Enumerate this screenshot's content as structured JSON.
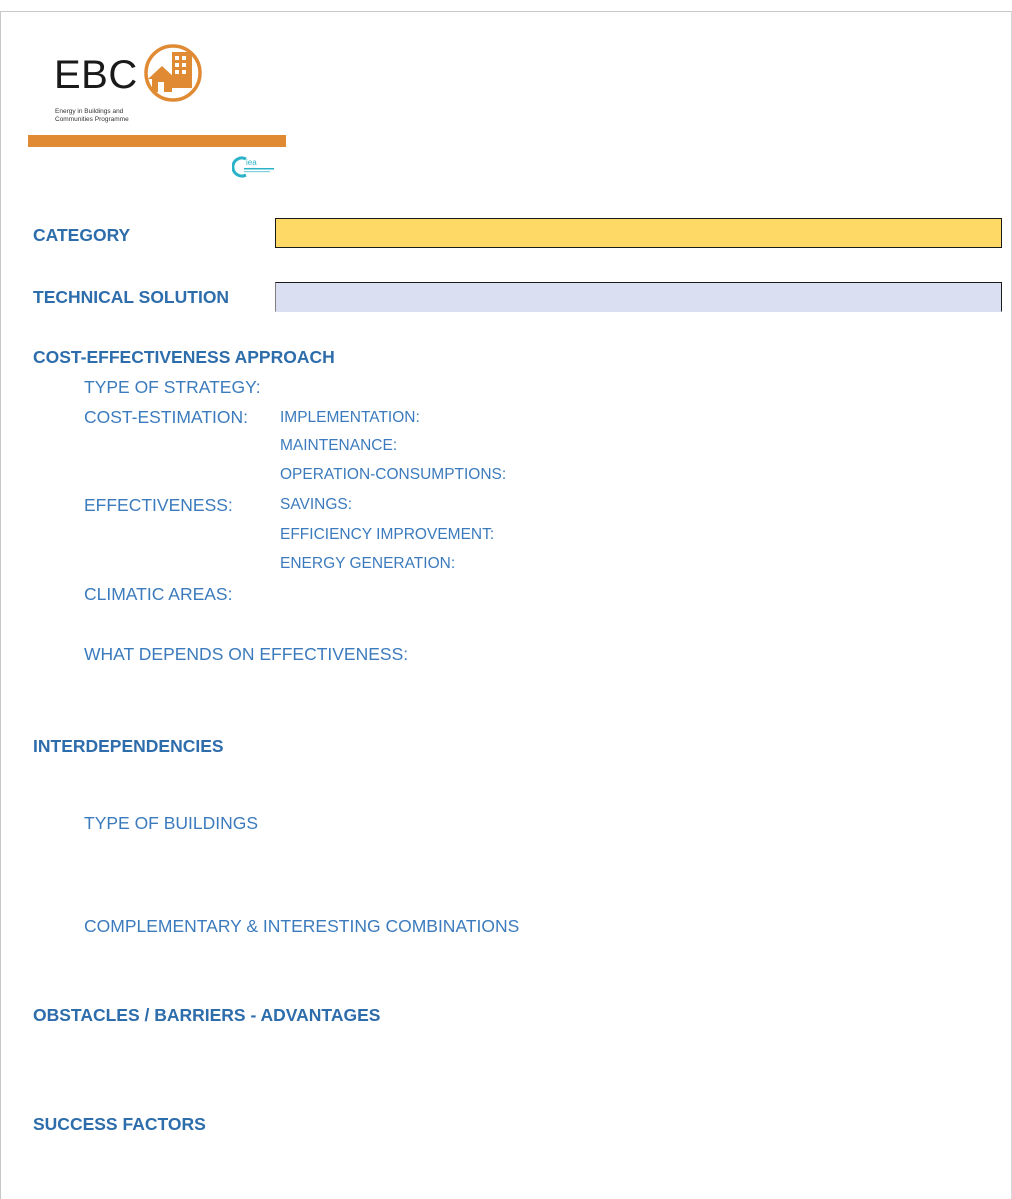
{
  "logo": {
    "brand": "EBC",
    "tagline": "Energy in Buildings and\nCommunities Programme",
    "iea_mark": "iea",
    "colors": {
      "orange": "#e08a34",
      "iea_teal": "#2ab3c8"
    }
  },
  "fields": {
    "category": {
      "label": "CATEGORY",
      "value": "",
      "fill": "#ffd966"
    },
    "technical_solution": {
      "label": "TECHNICAL SOLUTION",
      "value": "",
      "fill": "#dae0f2"
    }
  },
  "cost_effectiveness": {
    "heading": "COST-EFFECTIVENESS APPROACH",
    "type_of_strategy": "TYPE OF STRATEGY:",
    "cost_estimation": {
      "label": "COST-ESTIMATION:",
      "items": [
        "IMPLEMENTATION:",
        "MAINTENANCE:",
        "OPERATION-CONSUMPTIONS:"
      ]
    },
    "effectiveness": {
      "label": "EFFECTIVENESS:",
      "items": [
        "SAVINGS:",
        "EFFICIENCY IMPROVEMENT:",
        "ENERGY GENERATION:"
      ]
    },
    "climatic_areas": "CLIMATIC AREAS:",
    "what_depends": "WHAT DEPENDS ON EFFECTIVENESS:"
  },
  "interdependencies": {
    "heading": "INTERDEPENDENCIES",
    "type_of_buildings": "TYPE OF BUILDINGS",
    "combinations": "COMPLEMENTARY & INTERESTING COMBINATIONS"
  },
  "obstacles": {
    "heading": "OBSTACLES / BARRIERS - ADVANTAGES"
  },
  "success": {
    "heading": "SUCCESS FACTORS"
  }
}
